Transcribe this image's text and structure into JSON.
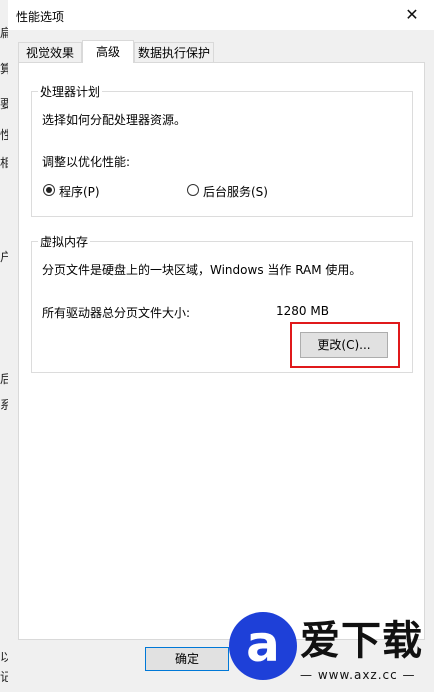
{
  "background_window": {
    "fragments": [
      "扁",
      "算",
      "要",
      "性",
      "相",
      "户",
      "后",
      "系",
      "以",
      "记"
    ]
  },
  "dialog": {
    "title": "性能选项",
    "close_icon": "close-icon",
    "tabs": [
      {
        "label": "视觉效果",
        "active": false
      },
      {
        "label": "高级",
        "active": true
      },
      {
        "label": "数据执行保护",
        "active": false
      }
    ],
    "processor": {
      "legend": "处理器计划",
      "description": "选择如何分配处理器资源。",
      "adjust_label": "调整以优化性能:",
      "options": [
        {
          "label": "程序(P)",
          "checked": true
        },
        {
          "label": "后台服务(S)",
          "checked": false
        }
      ]
    },
    "virtual_memory": {
      "legend": "虚拟内存",
      "description": "分页文件是硬盘上的一块区域，Windows 当作 RAM 使用。",
      "total_label": "所有驱动器总分页文件大小:",
      "total_value": "1280 MB",
      "change_button": "更改(C)..."
    },
    "ok_button": "确定",
    "highlight_color": "#e0191b"
  },
  "watermark": {
    "logo_letter": "a",
    "name": "爱下载",
    "url": "— www.axz.cc —"
  }
}
